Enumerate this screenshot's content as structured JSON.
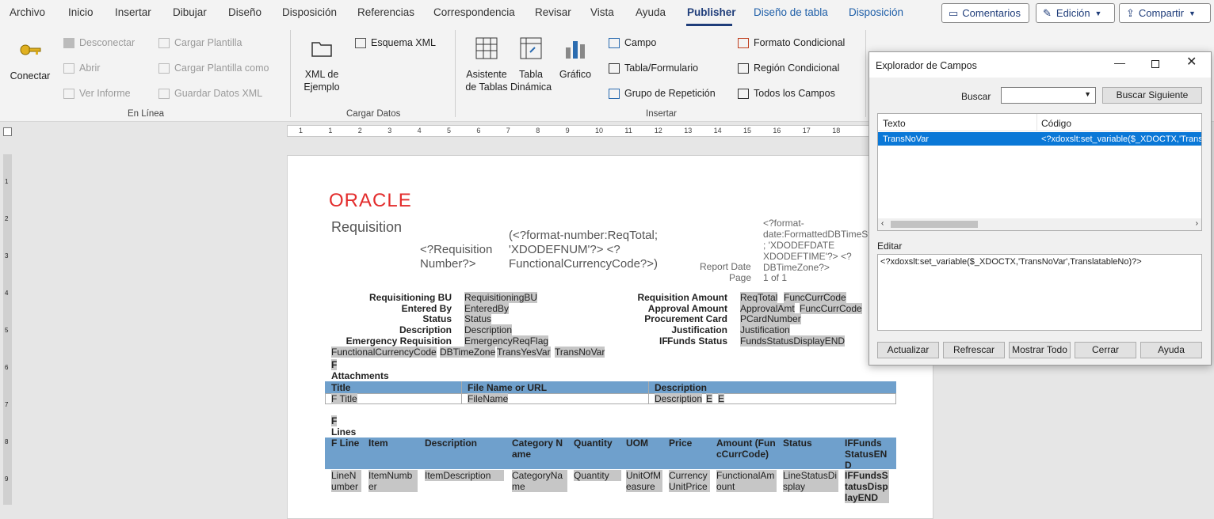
{
  "menu": {
    "items": [
      "Archivo",
      "Inicio",
      "Insertar",
      "Dibujar",
      "Diseño",
      "Disposición",
      "Referencias",
      "Correspondencia",
      "Revisar",
      "Vista",
      "Ayuda",
      "Publisher",
      "Diseño de tabla",
      "Disposición"
    ],
    "comments": "Comentarios",
    "editing": "Edición",
    "share": "Compartir"
  },
  "ribbon": {
    "online": {
      "connect": "Conectar",
      "disconnect": "Desconectar",
      "open": "Abrir",
      "view_report": "Ver Informe",
      "load_template": "Cargar Plantilla",
      "load_template_as": "Cargar Plantilla como",
      "save_xml": "Guardar Datos XML",
      "group": "En Línea"
    },
    "load": {
      "sample_xml": "XML de Ejemplo",
      "xml_schema": "Esquema XML",
      "group": "Cargar Datos"
    },
    "insert": {
      "table_wizard": "Asistente de Tablas",
      "pivot": "Tabla Dinámica",
      "chart": "Gráfico",
      "field": "Campo",
      "table_form": "Tabla/Formulario",
      "repeat_group": "Grupo de Repetición",
      "cond_format": "Formato Condicional",
      "cond_region": "Región Condicional",
      "all_fields": "Todos los Campos",
      "group": "Insertar"
    }
  },
  "ruler": {
    "ticks": [
      "1",
      "1",
      "2",
      "3",
      "4",
      "5",
      "6",
      "7",
      "8",
      "9",
      "10",
      "11",
      "12",
      "13",
      "14",
      "15",
      "16",
      "17",
      "18"
    ]
  },
  "vruler": {
    "ticks": [
      "1",
      "2",
      "3",
      "4",
      "5",
      "6",
      "7",
      "8",
      "9"
    ]
  },
  "doc": {
    "logo": "ORACLE",
    "title": "Requisition",
    "req_num": "<?Requisition Number?>",
    "req_total": "(<?format-number:ReqTotal; 'XDODEFNUM'?> <?FunctionalCurrencyCode?>)",
    "date_code": "<?format-date:FormattedDBTimeSt ; 'XDODEFDATE XDODEFTIME'?> <?DBTimeZone?>",
    "report_date": "Report Date",
    "page": "Page",
    "page_of": "1 of 1",
    "left_labels": [
      "Requisitioning BU",
      "Entered By",
      "Status",
      "Description",
      "Emergency Requisition"
    ],
    "left_vals": [
      "RequisitioningBU",
      "EnteredBy",
      "Status",
      "Description",
      "EmergencyReqFlag"
    ],
    "right_labels": [
      "Requisition Amount",
      "Approval Amount",
      "Procurement Card",
      "Justification",
      "Funds Status"
    ],
    "right_vals": [
      "ReqTotal",
      "ApprovalAmt",
      "PCardNumber",
      "Justification",
      "FundsStatusDisplayEND"
    ],
    "right_vals2": [
      "FuncCurrCode",
      "FuncCurrCode"
    ],
    "if_mark": "IF",
    "hidden": [
      "FunctionalCurrencyCode",
      "DBTimeZone",
      "TransYesVar",
      "TransNoVar"
    ],
    "f": "F",
    "attachments": "Attachments",
    "att_head": [
      "Title",
      "File Name or URL",
      "Description"
    ],
    "att_row": [
      "F Title",
      "FileName",
      "Description",
      "E",
      "E"
    ],
    "lines": "Lines",
    "lines_head": [
      "F Line",
      "Item",
      "Description",
      "Category Name",
      "Quantity",
      "UOM",
      "Price",
      "Amount (FuncCurrCode)",
      "Status",
      "IFFunds StatusEND"
    ],
    "lines_row": [
      "LineNumber",
      "ItemNumber",
      "ItemDescription",
      "CategoryName",
      "Quantity",
      "UnitOfMeasure",
      "CurrencyUnitPrice",
      "FunctionalAmount",
      "LineStatusDisplay",
      "IFFundsStatusDisplayEND"
    ]
  },
  "dialog": {
    "title": "Explorador de Campos",
    "search_label": "Buscar",
    "find_next": "Buscar Siguiente",
    "col_text": "Texto",
    "col_code": "Código",
    "row_text": "TransNoVar",
    "row_code": "<?xdoxslt:set_variable($_XDOCTX,'TransN",
    "edit_label": "Editar",
    "edit_value": "<?xdoxslt:set_variable($_XDOCTX,'TransNoVar',TranslatableNo)?>",
    "buttons": [
      "Actualizar",
      "Refrescar",
      "Mostrar Todo",
      "Cerrar",
      "Ayuda"
    ]
  }
}
